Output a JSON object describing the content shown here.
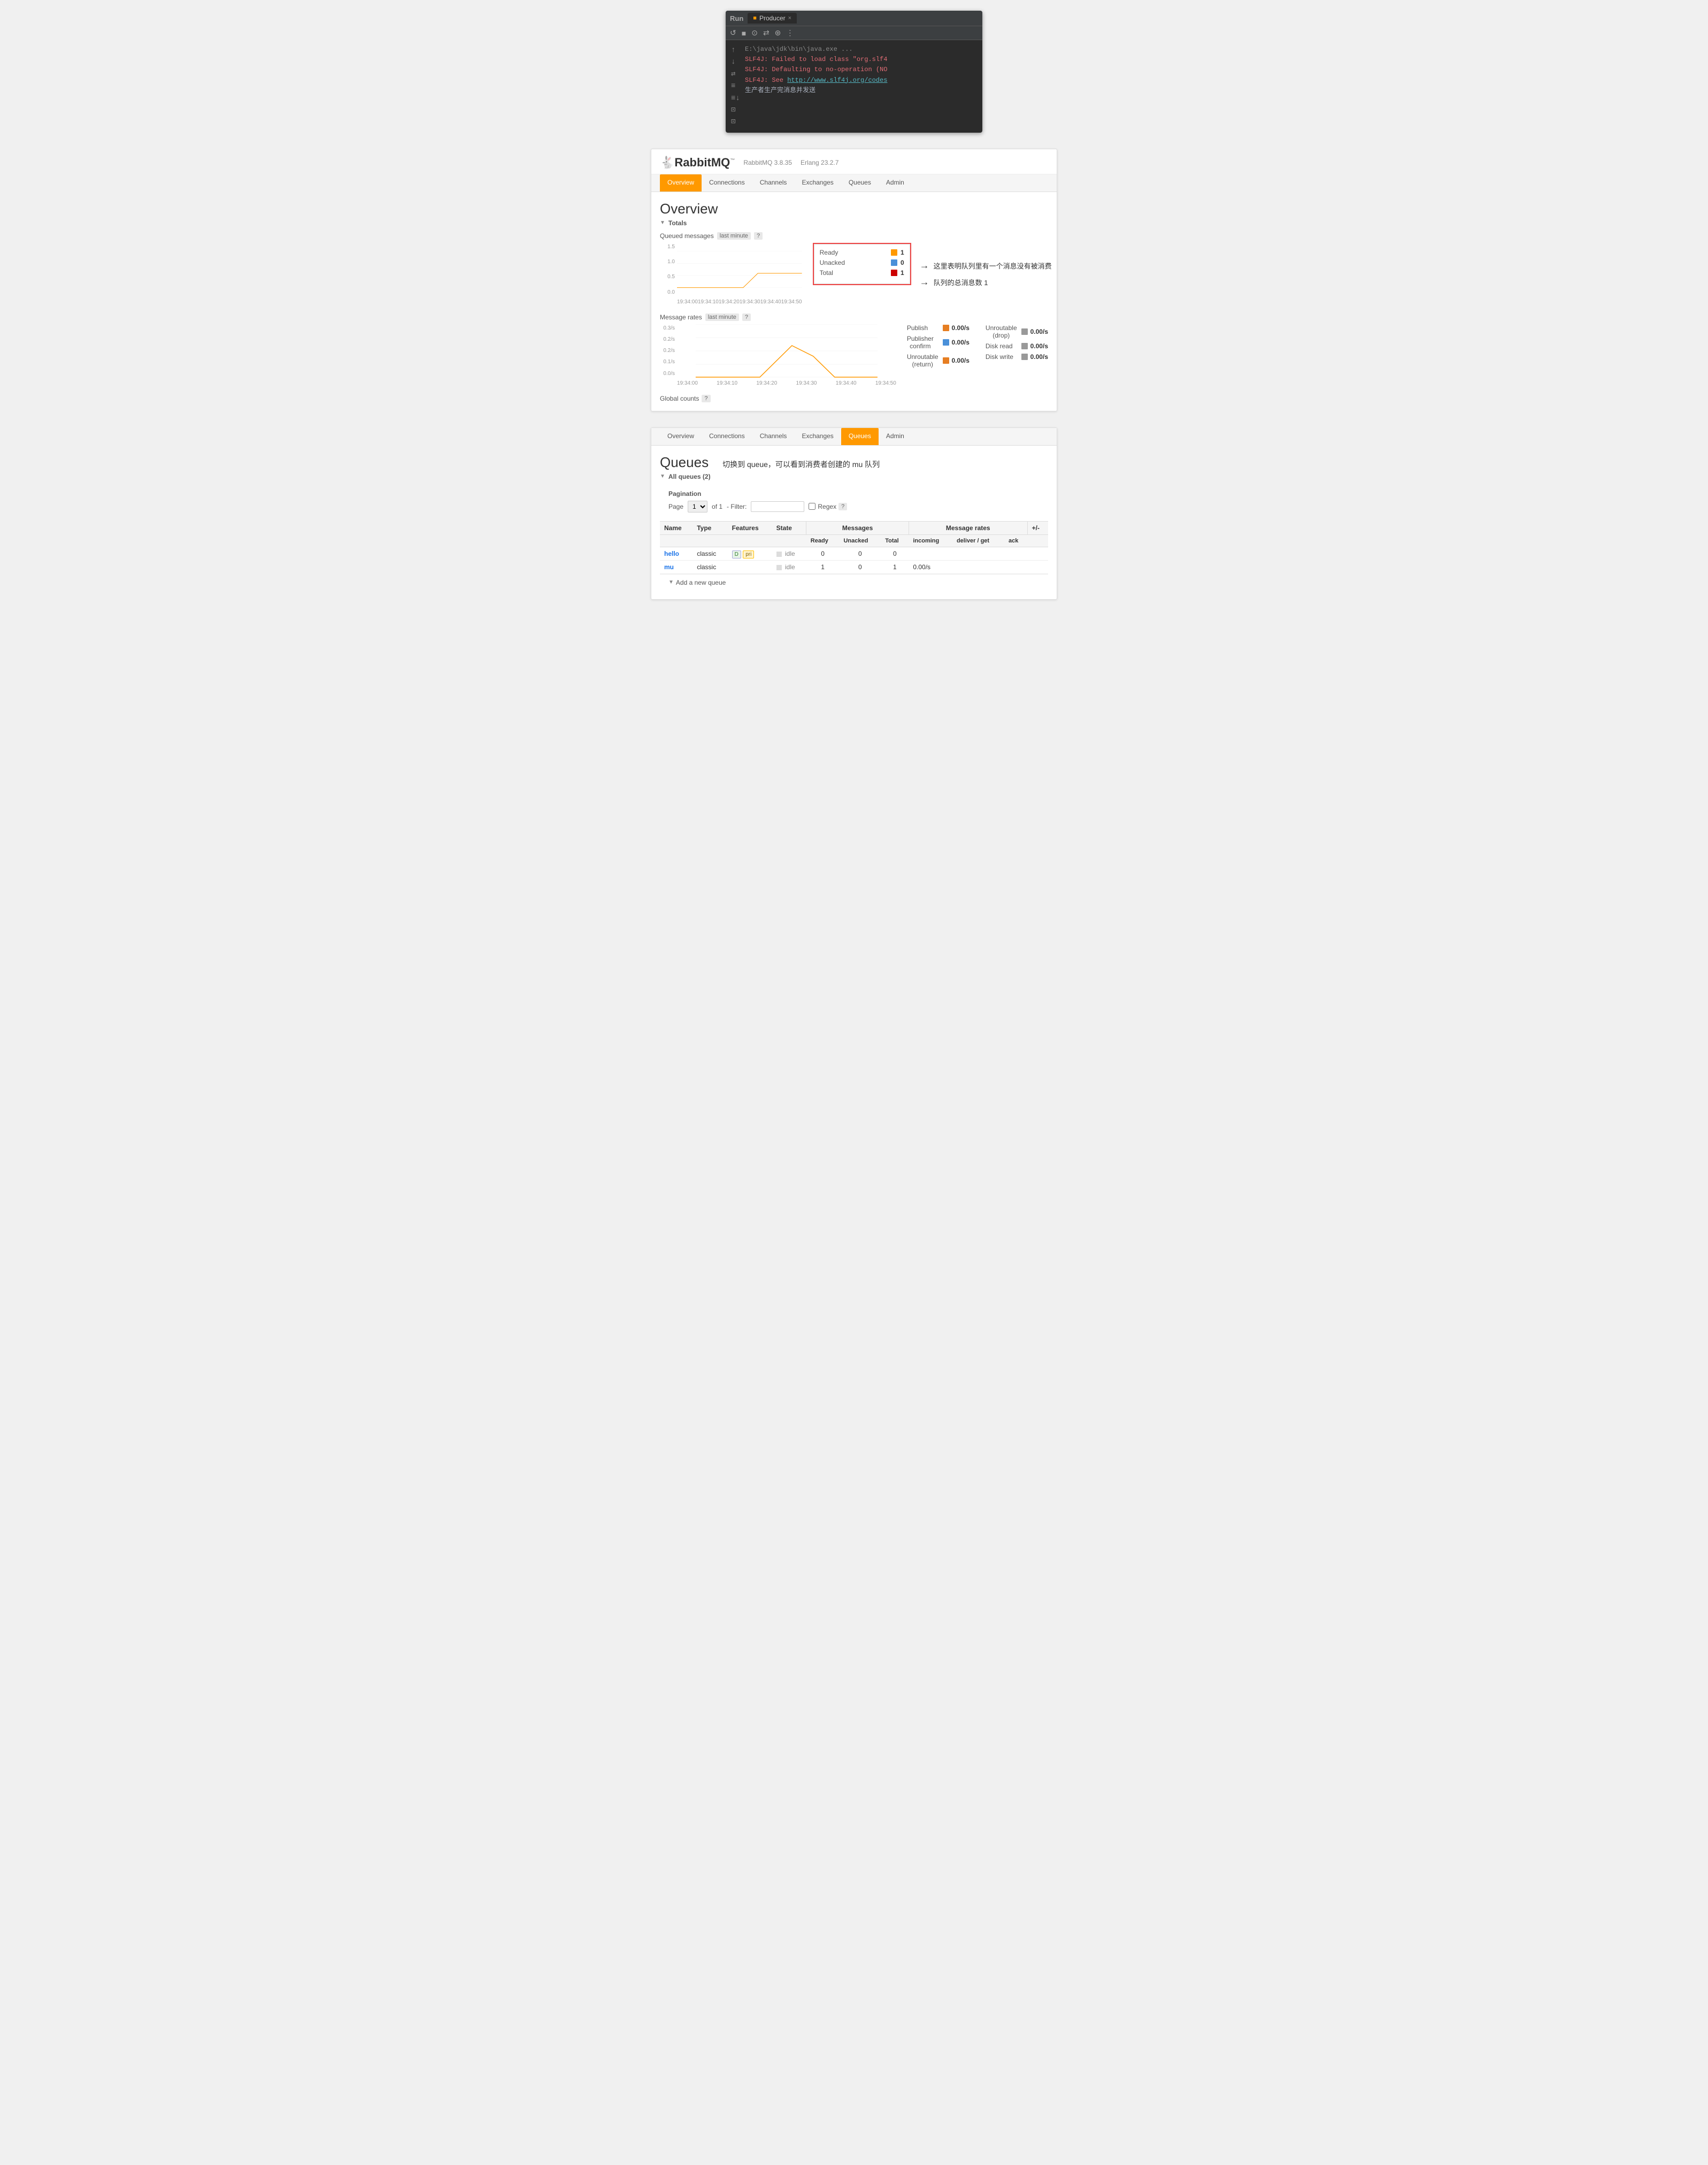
{
  "ide": {
    "tab_run": "Run",
    "tab_name": "Producer",
    "close_label": "×",
    "toolbar_icons": [
      "↺",
      "■",
      "⊙",
      "⇄",
      "⊛",
      "⋮"
    ],
    "lines": [
      {
        "gutter": "↑",
        "text": "E:\\java\\jdk\\bin\\java.exe ...",
        "style": "gray"
      },
      {
        "gutter": "↓",
        "text": "SLF4J: Failed to load class \"org.slf4",
        "style": "red"
      },
      {
        "gutter": "⇄",
        "text": "SLF4J: Defaulting to no-operation (NO",
        "style": "red"
      },
      {
        "gutter": "≡",
        "text": "SLF4J: See http://www.slf4j.org/codes",
        "style": "red-link"
      },
      {
        "gutter": "≡↓",
        "text": "生产者生产完消息并发送",
        "style": "white"
      },
      {
        "gutter": "⊡",
        "text": "",
        "style": "white"
      }
    ]
  },
  "rmq": {
    "logo_text": "RabbitMQ",
    "logo_tm": "™",
    "version": "RabbitMQ 3.8.35",
    "erlang": "Erlang 23.2.7",
    "nav_items": [
      "Overview",
      "Connections",
      "Channels",
      "Exchanges",
      "Queues",
      "Admin"
    ],
    "nav_active": "Overview",
    "page_title": "Overview",
    "section_totals": "Totals",
    "queued_label": "Queued messages",
    "queued_badge": "last minute",
    "queued_help": "?",
    "chart1_xaxis": [
      "19:34:00",
      "19:34:10",
      "19:34:20",
      "19:34:30",
      "19:34:40",
      "19:34:50"
    ],
    "chart1_y": [
      "1.5",
      "1.0",
      "0.5",
      "0.0"
    ],
    "legend1": [
      {
        "label": "Ready",
        "value": "1",
        "dot": "yellow"
      },
      {
        "label": "Unacked",
        "value": "0",
        "dot": "blue"
      },
      {
        "label": "Total",
        "value": "1",
        "dot": "red"
      }
    ],
    "annotation1": "这里表明队列里有一个消息没有被消费",
    "annotation2": "队列的总消息数 1",
    "rates_label": "Message rates",
    "rates_badge": "last minute",
    "chart2_xaxis": [
      "19:34:00",
      "19:34:10",
      "19:34:20",
      "19:34:30",
      "19:34:40",
      "19:34:50"
    ],
    "chart2_y": [
      "0.3/s",
      "0.2/s",
      "0.2/s",
      "0.2/s",
      "0.1/s",
      "0.1/s",
      "0.0/s"
    ],
    "rates_left": [
      {
        "label": "Publish",
        "value": "0.00/s",
        "dot": "orange"
      },
      {
        "label": "Publisher confirm",
        "value": "0.00/s",
        "dot": "blue"
      },
      {
        "label": "Unroutable (return)",
        "value": "0.00/s",
        "dot": "orange"
      }
    ],
    "rates_right": [
      {
        "label": "Unroutable (drop)",
        "value": "0.00/s",
        "dot": "gray"
      },
      {
        "label": "Disk read",
        "value": "0.00/s",
        "dot": "gray"
      },
      {
        "label": "Disk write",
        "value": "0.00/s",
        "dot": "gray"
      }
    ],
    "global_counts": "Global counts",
    "global_help": "?"
  },
  "queues": {
    "nav_items": [
      "Overview",
      "Connections",
      "Channels",
      "Exchanges",
      "Queues",
      "Admin"
    ],
    "nav_active": "Queues",
    "page_title": "Queues",
    "section_label": "All queues (2)",
    "annotation": "切换到 queue，可以看到消费者创建的 mu 队列",
    "pagination_label": "Pagination",
    "page_label": "Page",
    "page_value": "1",
    "of_label": "of 1",
    "filter_label": "- Filter:",
    "regex_label": "Regex",
    "help": "?",
    "table_headers_overview": [
      "Name",
      "Type",
      "Features",
      "State"
    ],
    "table_messages": "Messages",
    "table_messages_cols": [
      "Ready",
      "Unacked",
      "Total"
    ],
    "table_rates": "Message rates",
    "table_rates_cols": [
      "incoming",
      "deliver / get",
      "ack"
    ],
    "table_pm": "+/-",
    "rows": [
      {
        "name": "hello",
        "type": "classic",
        "features": [
          "D",
          "pri"
        ],
        "state": "idle",
        "ready": "0",
        "unacked": "0",
        "total": "0",
        "incoming": "",
        "deliver": "",
        "ack": ""
      },
      {
        "name": "mu",
        "type": "classic",
        "features": [],
        "state": "idle",
        "ready": "1",
        "unacked": "0",
        "total": "1",
        "incoming": "0.00/s",
        "deliver": "",
        "ack": ""
      }
    ],
    "add_queue": "Add a new queue"
  }
}
